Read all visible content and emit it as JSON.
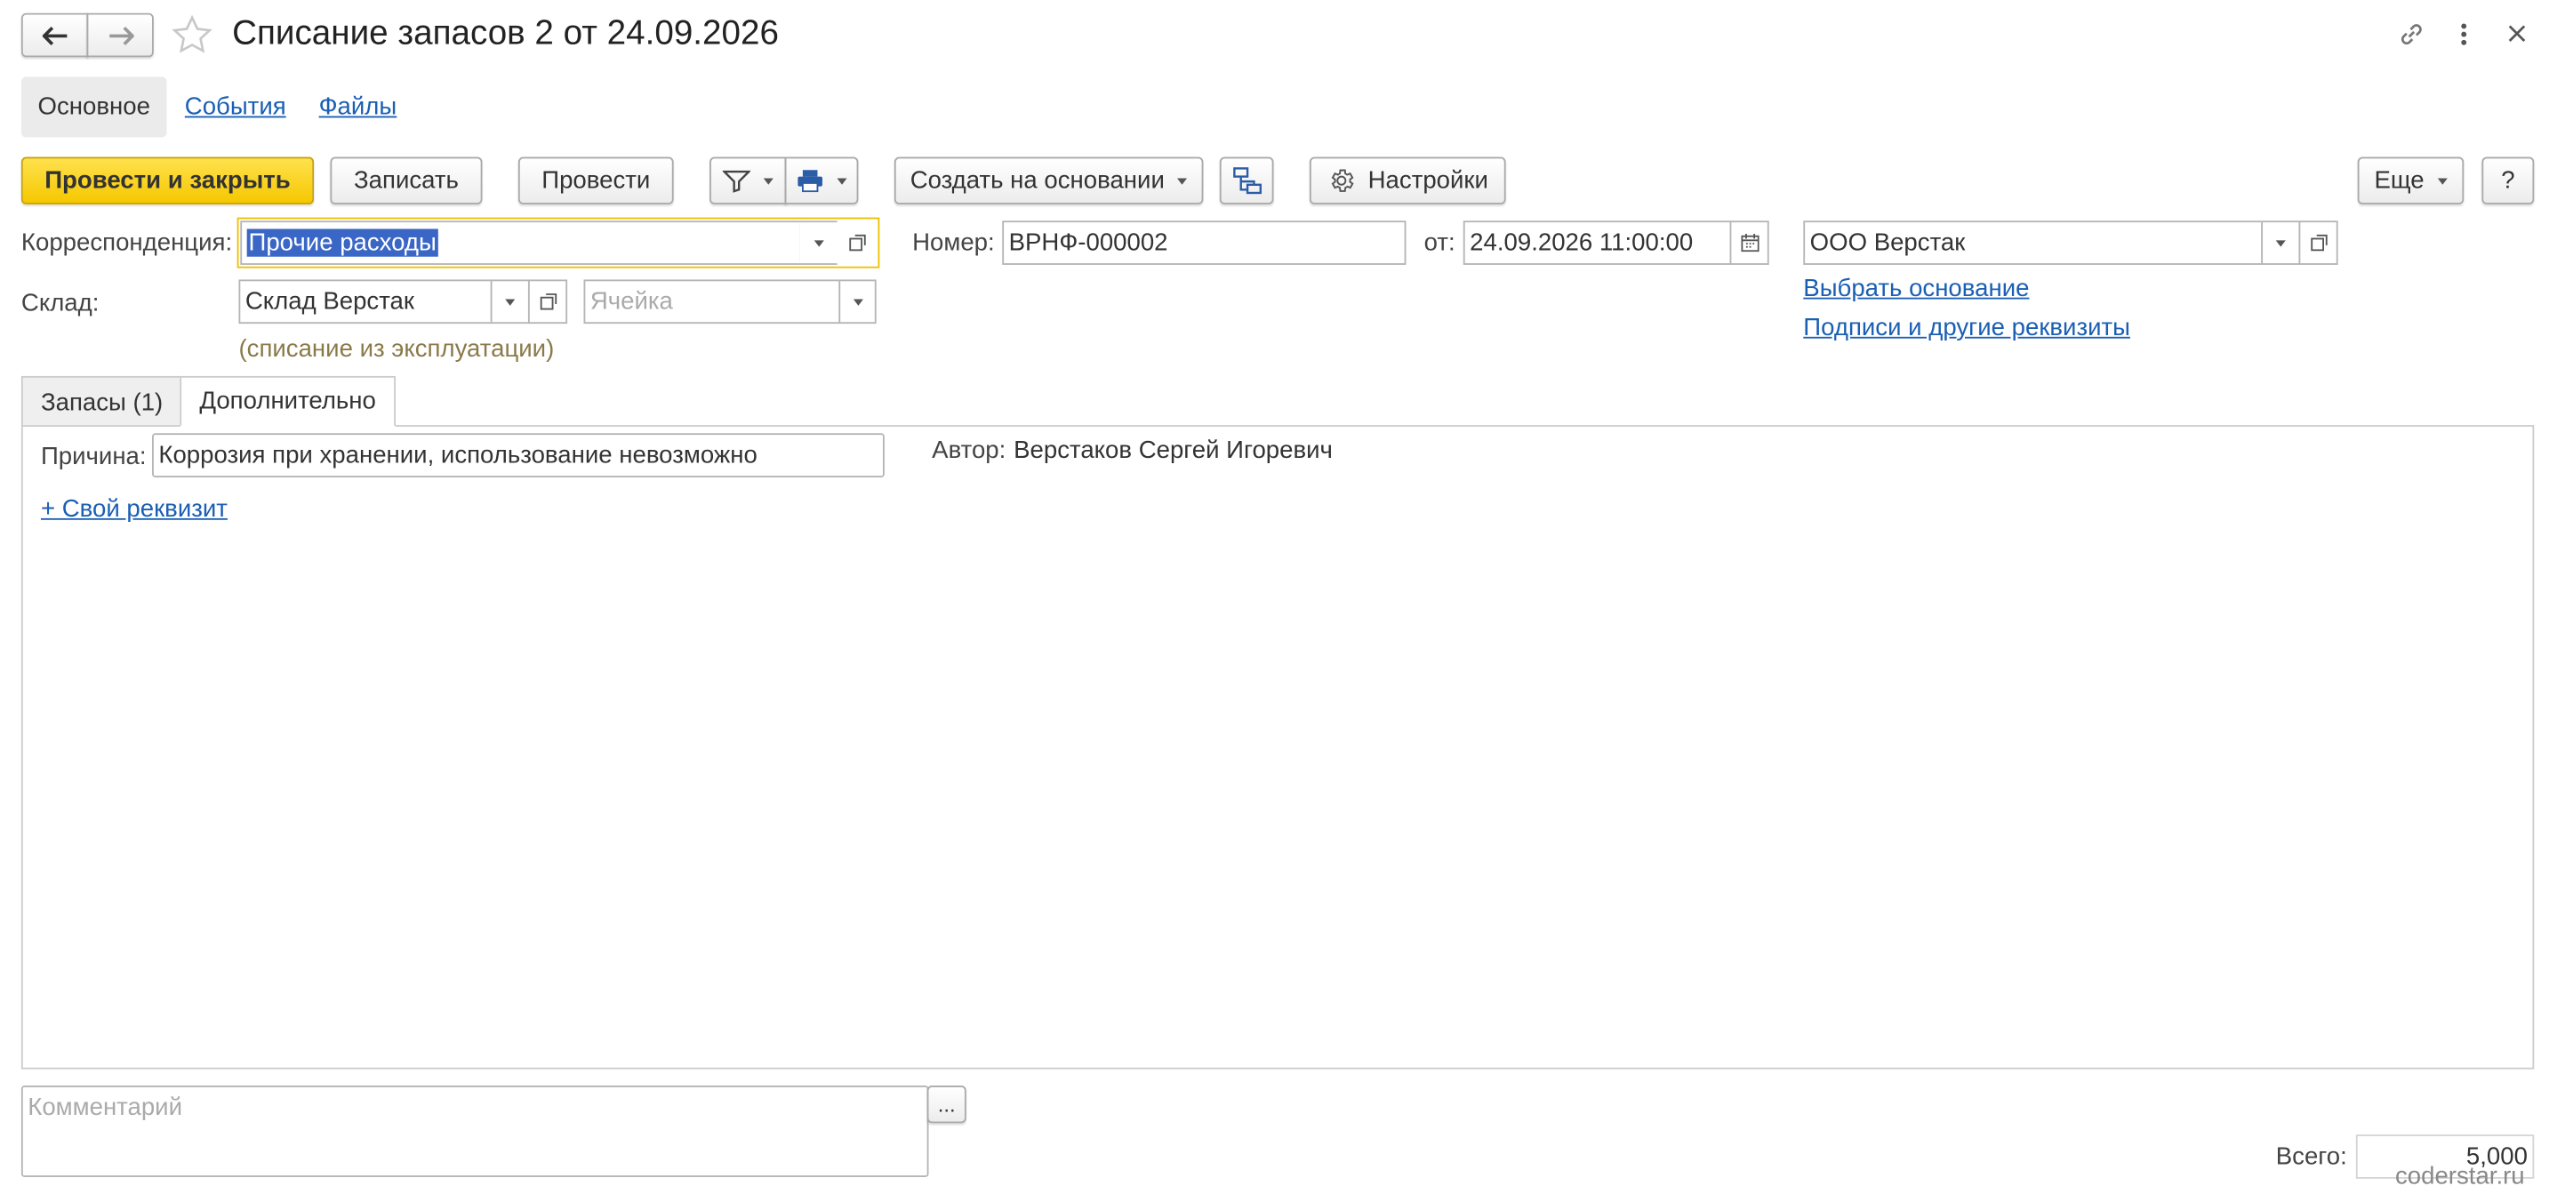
{
  "window": {
    "title": "Списание запасов 2 от 24.09.2026",
    "back_icon": "arrow-left-icon",
    "forward_icon": "arrow-right-icon",
    "favorite_icon": "star-icon",
    "link_icon": "link-icon",
    "menu_icon": "more-vertical-icon",
    "close_icon": "close-icon"
  },
  "nav_tabs": [
    {
      "label": "Основное",
      "active": true
    },
    {
      "label": "События",
      "active": false
    },
    {
      "label": "Файлы",
      "active": false
    }
  ],
  "toolbar": {
    "post_close_label": "Провести и закрыть",
    "save_label": "Записать",
    "post_label": "Провести",
    "filter_icon": "filter-icon",
    "print_icon": "print-icon",
    "create_basis_label": "Создать на основании",
    "structure_icon": "document-structure-icon",
    "settings_label": "Настройки",
    "settings_icon": "gear-icon",
    "more_label": "Еще",
    "help_label": "?"
  },
  "form": {
    "correspondence_label": "Корреспонденция:",
    "correspondence_value": "Прочие расходы",
    "number_label": "Номер:",
    "number_value": "ВРНФ-000002",
    "date_label": "от:",
    "date_value": "24.09.2026 11:00:00",
    "calendar_icon": "calendar-icon",
    "organization_value": "ООО Верстак",
    "warehouse_label": "Склад:",
    "warehouse_value": "Склад Верстак",
    "cell_placeholder": "Ячейка",
    "warehouse_note": "(списание из эксплуатации)",
    "choose_basis_link": "Выбрать основание",
    "signatures_link": "Подписи и другие реквизиты"
  },
  "inner_tabs": [
    {
      "label": "Запасы (1)",
      "active": false
    },
    {
      "label": "Дополнительно",
      "active": true
    }
  ],
  "additional": {
    "reason_label": "Причина:",
    "reason_value": "Коррозия при хранении, использование невозможно",
    "author_label": "Автор:",
    "author_value": "Верстаков Сергей Игоревич",
    "custom_attr_link": "+ Свой реквизит"
  },
  "footer": {
    "comment_placeholder": "Комментарий",
    "comment_button": "...",
    "total_label": "Всего:",
    "total_value": "5,000"
  },
  "watermark": "coderstar.ru",
  "colors": {
    "primary_button": "#f5c800",
    "link": "#1a5fb4",
    "active_field_border": "#f0c000",
    "note_text": "#8a7a4a",
    "selection": "#3a66c5"
  }
}
